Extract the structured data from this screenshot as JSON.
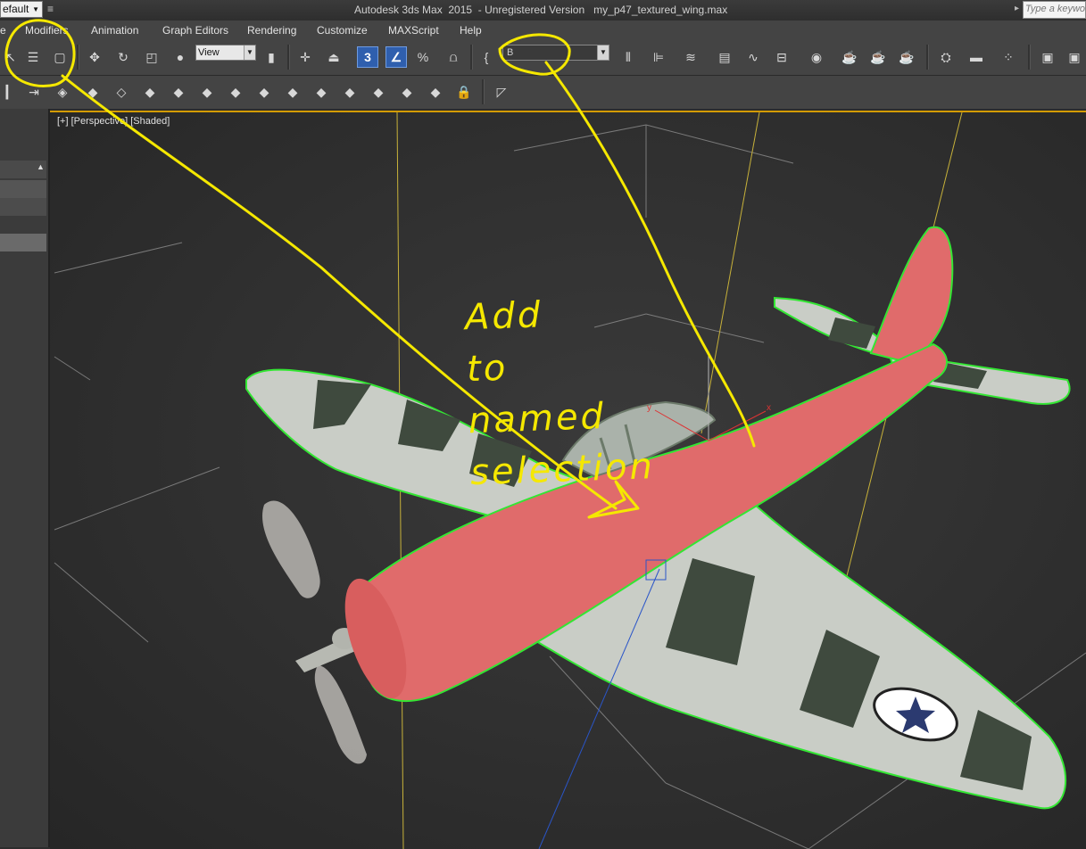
{
  "title_bar": {
    "workspace": "efault",
    "title": "Autodesk 3ds Max  2015  - Unregistered Version   my_p47_textured_wing.max",
    "search_placeholder": "Type a keyword"
  },
  "menu": {
    "items": [
      "e",
      "Modifiers",
      "Animation",
      "Graph Editors",
      "Rendering",
      "Customize",
      "MAXScript",
      "Help"
    ]
  },
  "main_toolbar": {
    "reference_coordinate": "View",
    "named_selection_set": "B",
    "snap_label": "3",
    "percent_snap_label": "%"
  },
  "viewport": {
    "label": "[+] [Perspective] [Shaded]",
    "gizmo_axes": [
      "y",
      "x"
    ]
  },
  "annotation": {
    "lines": [
      "Add",
      "to",
      "named",
      "selection"
    ],
    "color": "#f5e800"
  },
  "colors": {
    "fuselage_selected": "#e06b6b",
    "selection_outline": "#33e633",
    "wing_light": "#c9cdc6",
    "wing_camo": "#3f4a3e",
    "viewport_bg": "#2f2f2f"
  }
}
